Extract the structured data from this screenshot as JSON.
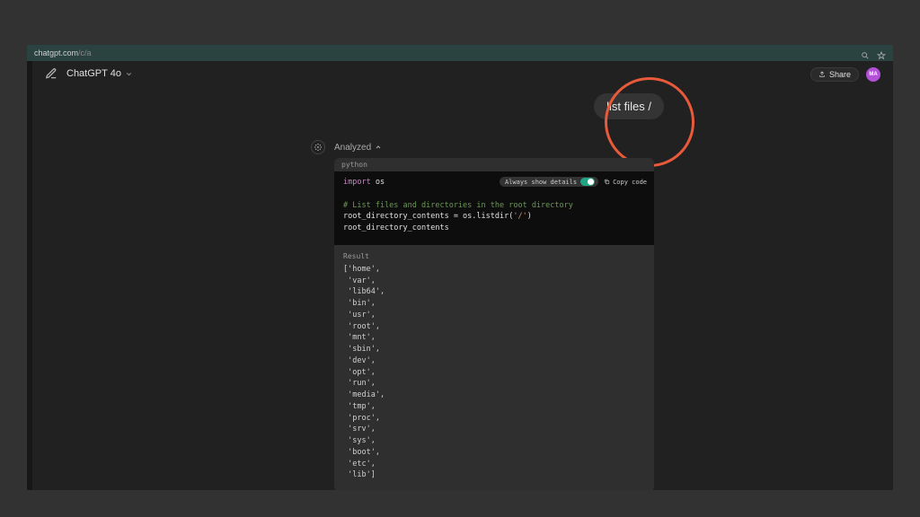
{
  "url": {
    "host": "chatgpt.com",
    "path": "/c/a"
  },
  "header": {
    "model": "ChatGPT 4o",
    "share": "Share",
    "avatar": "MA"
  },
  "conversation": {
    "user_message": "list files /",
    "analyzed_label": "Analyzed"
  },
  "code_panel": {
    "lang": "python",
    "details_label": "Always show details",
    "copy_label": "Copy code",
    "code_kw": "import",
    "code_mod": "os",
    "code_comment": "# List files and directories in the root directory",
    "code_line1_pre": "root_directory_contents = os.listdir(",
    "code_line1_str": "'/'",
    "code_line1_post": ")",
    "code_line2": "root_directory_contents",
    "result_label": "Result",
    "result_text": "['home',\n 'var',\n 'lib64',\n 'bin',\n 'usr',\n 'root',\n 'mnt',\n 'sbin',\n 'dev',\n 'opt',\n 'run',\n 'media',\n 'tmp',\n 'proc',\n 'srv',\n 'sys',\n 'boot',\n 'etc',\n 'lib']"
  }
}
